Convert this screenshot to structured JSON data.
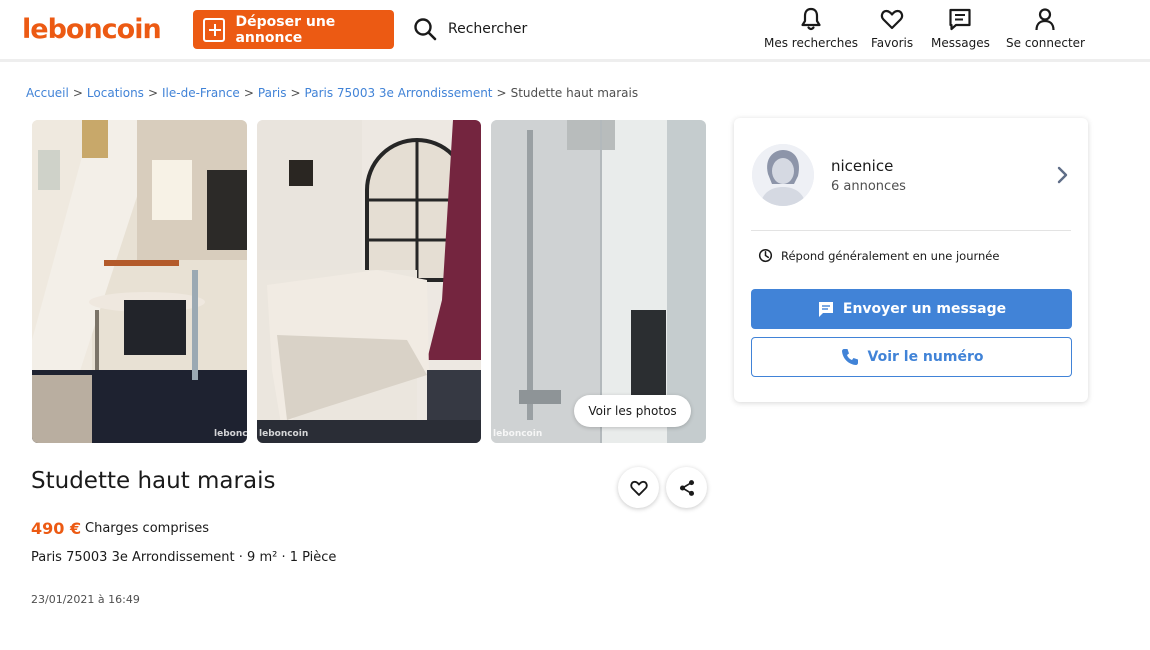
{
  "header": {
    "logo": "leboncoin",
    "post_button": "Déposer une annonce",
    "search_label": "Rechercher",
    "nav": [
      {
        "label": "Mes recherches",
        "icon": "bell-icon"
      },
      {
        "label": "Favoris",
        "icon": "heart-icon"
      },
      {
        "label": "Messages",
        "icon": "message-icon"
      },
      {
        "label": "Se connecter",
        "icon": "user-icon"
      }
    ]
  },
  "breadcrumb": {
    "items": [
      "Accueil",
      "Locations",
      "Ile-de-France",
      "Paris",
      "Paris 75003 3e Arrondissement"
    ],
    "current": "Studette haut marais",
    "separator": ">"
  },
  "gallery": {
    "watermark": "leboncoin",
    "view_photos_button": "Voir les photos"
  },
  "listing": {
    "title": "Studette haut marais",
    "price": "490 €",
    "charges": "Charges comprises",
    "location": "Paris 75003 3e Arrondissement · 9 m² · 1 Pièce",
    "date": "23/01/2021 à 16:49"
  },
  "seller": {
    "name": "nicenice",
    "listings_count": "6 annonces",
    "response_time": "Répond généralement en une journée",
    "message_button": "Envoyer un message",
    "phone_button": "Voir le numéro"
  },
  "colors": {
    "brand_orange": "#ec5a13",
    "accent_blue": "#4183d7"
  }
}
